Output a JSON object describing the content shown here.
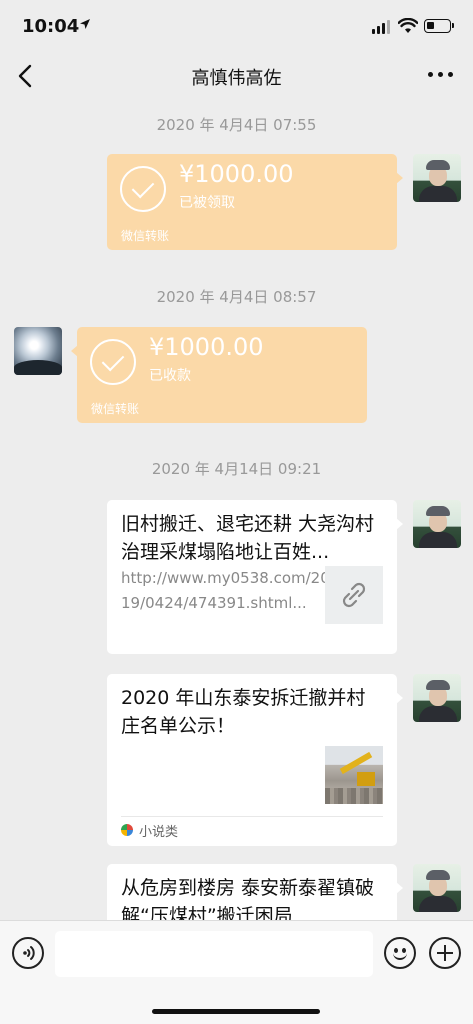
{
  "status_bar": {
    "time": "10:04",
    "location_icon": "location-arrow-icon",
    "signal_icon": "cellular-signal-icon",
    "wifi_icon": "wifi-icon",
    "battery_icon": "battery-icon",
    "battery_level": 0.35
  },
  "header": {
    "title": "高慎伟高佐",
    "back_icon": "chevron-left-icon",
    "more_icon": "more-dots-icon"
  },
  "messages": [
    {
      "type": "timestamp",
      "text": "2020 年 4月4日 07:55"
    },
    {
      "type": "transfer",
      "from": "me",
      "amount": "¥1000.00",
      "status": "已被领取",
      "footer": "微信转账",
      "color": "#fbd9a8"
    },
    {
      "type": "timestamp",
      "text": "2020 年 4月4日 08:57"
    },
    {
      "type": "transfer",
      "from": "other",
      "amount": "¥1000.00",
      "status": "已收款",
      "footer": "微信转账",
      "color": "#fbd9a8"
    },
    {
      "type": "timestamp",
      "text": "2020 年 4月14日 09:21"
    },
    {
      "type": "link",
      "from": "me",
      "title": "旧村搬迁、退宅还耕 大尧沟村治理采煤塌陷地让百姓...",
      "url": "http://www.my0538.com/2019/0424/474391.shtml...",
      "thumb_icon": "link-icon"
    },
    {
      "type": "article",
      "from": "me",
      "title": "2020 年山东泰安拆迁撤并村庄名单公示！",
      "source": "小说类",
      "source_icon": "app-logo-icon",
      "thumb": "excavator-photo"
    },
    {
      "type": "article",
      "from": "me",
      "title": "从危房到楼房 泰安新泰翟镇破解“压煤村”搬迁困局"
    }
  ],
  "input_bar": {
    "voice_icon": "voice-icon",
    "emoji_icon": "emoji-icon",
    "plus_icon": "plus-icon",
    "value": ""
  }
}
